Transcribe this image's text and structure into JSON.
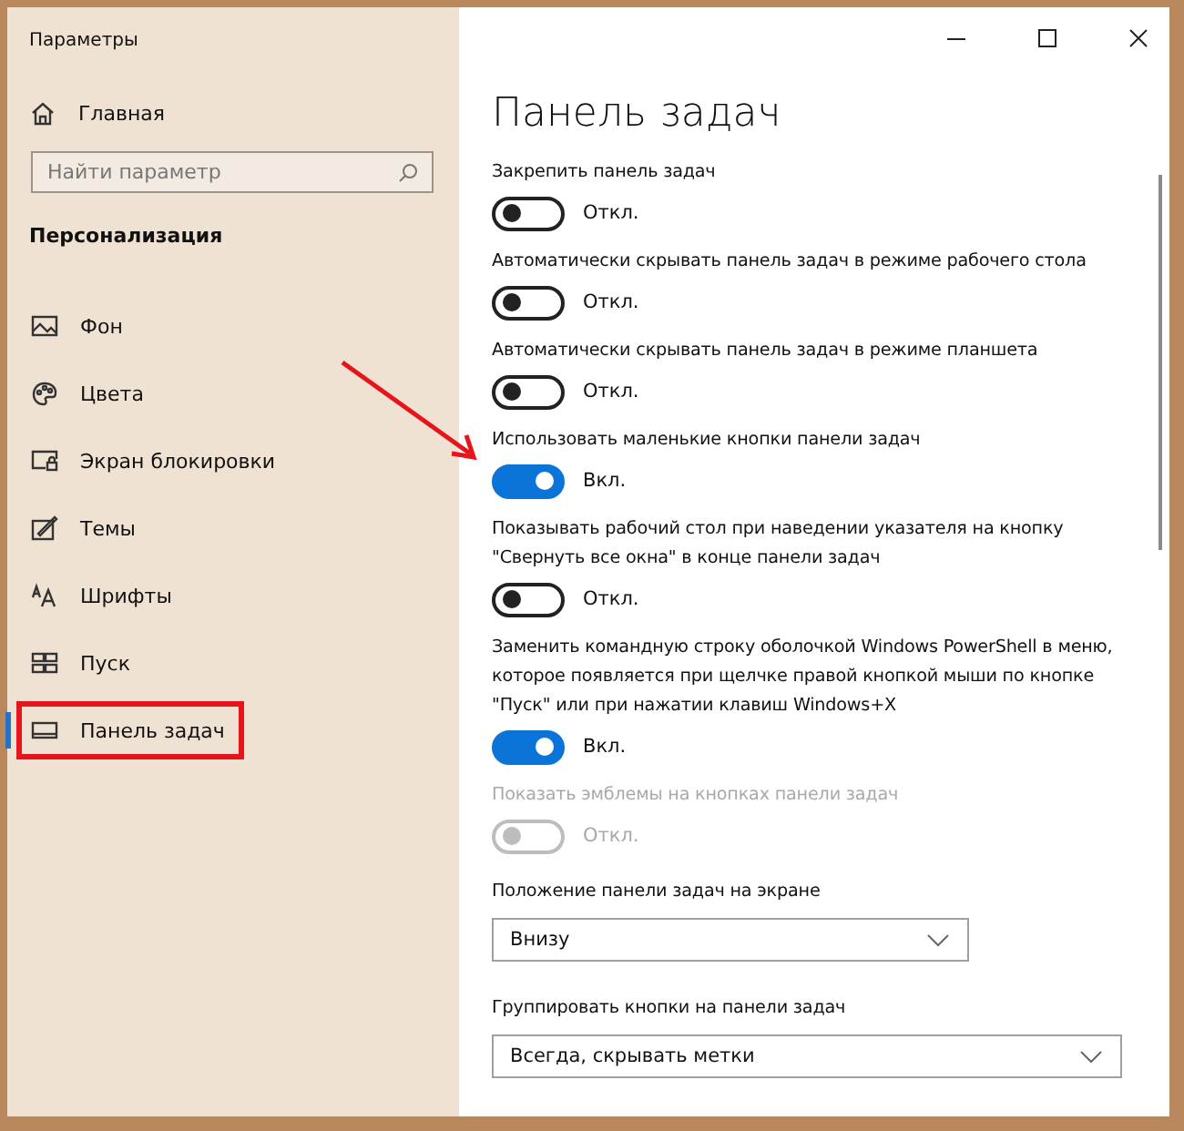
{
  "window": {
    "title": "Параметры"
  },
  "sidebar": {
    "home": "Главная",
    "search": {
      "placeholder": "Найти параметр"
    },
    "section": "Персонализация",
    "items": [
      {
        "kind": "background",
        "label": "Фон",
        "selected": false,
        "highlighted": false
      },
      {
        "kind": "colors",
        "label": "Цвета",
        "selected": false,
        "highlighted": false
      },
      {
        "kind": "lockscreen",
        "label": "Экран блокировки",
        "selected": false,
        "highlighted": false
      },
      {
        "kind": "themes",
        "label": "Темы",
        "selected": false,
        "highlighted": false
      },
      {
        "kind": "fonts",
        "label": "Шрифты",
        "selected": false,
        "highlighted": false
      },
      {
        "kind": "start",
        "label": "Пуск",
        "selected": false,
        "highlighted": false
      },
      {
        "kind": "taskbar",
        "label": "Панель задач",
        "selected": true,
        "highlighted": true
      }
    ]
  },
  "page": {
    "title": "Панель задач",
    "settings": [
      {
        "kind": "toggle",
        "label": "Закрепить панель задач",
        "on": false,
        "disabled": false,
        "state_text": "Откл.",
        "pointed": false
      },
      {
        "kind": "toggle",
        "label": "Автоматически скрывать панель задач в режиме рабочего стола",
        "on": false,
        "disabled": false,
        "state_text": "Откл.",
        "pointed": false
      },
      {
        "kind": "toggle",
        "label": "Автоматически скрывать панель задач в режиме планшета",
        "on": false,
        "disabled": false,
        "state_text": "Откл.",
        "pointed": false
      },
      {
        "kind": "toggle",
        "label": "Использовать маленькие кнопки панели задач",
        "on": true,
        "disabled": false,
        "state_text": "Вкл.",
        "pointed": true
      },
      {
        "kind": "toggle",
        "label": "Показывать рабочий стол при наведении указателя на кнопку \"Свернуть все окна\" в конце панели задач",
        "on": false,
        "disabled": false,
        "state_text": "Откл.",
        "pointed": false
      },
      {
        "kind": "toggle",
        "label": "Заменить командную строку оболочкой Windows PowerShell в меню, которое появляется при щелчке правой кнопкой мыши по кнопке \"Пуск\" или при нажатии клавиш Windows+X",
        "on": true,
        "disabled": false,
        "state_text": "Вкл.",
        "pointed": false
      },
      {
        "kind": "toggle",
        "label": "Показать эмблемы на кнопках панели задач",
        "on": false,
        "disabled": true,
        "state_text": "Откл.",
        "pointed": false
      },
      {
        "kind": "dropdown",
        "label": "Положение панели задач на экране",
        "value": "Внизу"
      },
      {
        "kind": "dropdown",
        "label": "Группировать кнопки на панели задач",
        "value": "Всегда, скрывать метки"
      }
    ]
  }
}
